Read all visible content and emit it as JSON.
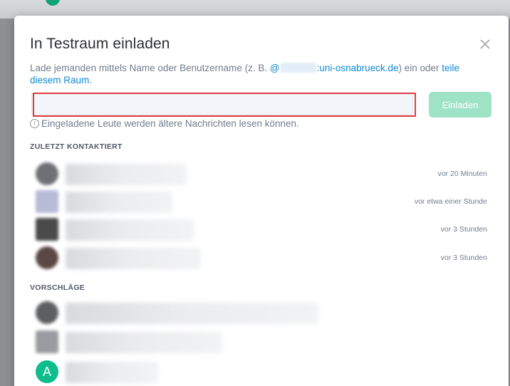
{
  "dialog": {
    "title": "In Testraum einladen",
    "description_prefix": "Lade jemanden mittels Name oder Benutzername (z. B. ",
    "mention_at": "@",
    "mention_domain": ":uni-osnabrueck.de",
    "description_middle": ") ein oder ",
    "share_link": "teile diesem Raum",
    "description_suffix": ".",
    "input": {
      "value": "",
      "placeholder": ""
    },
    "invite_button": "Einladen",
    "hint": "Eingeladene Leute werden ältere Nachrichten lesen können.",
    "close_icon": "close-icon",
    "accent_color": "#0dbd8b",
    "highlight_color": "#e03a41"
  },
  "recent": {
    "heading": "ZULETZT KONTAKTIERT",
    "items": [
      {
        "time": "vor 20 Minuten"
      },
      {
        "time": "vor etwa einer Stunde"
      },
      {
        "time": "vor 3 Stunden"
      },
      {
        "time": "vor 3 Stunden"
      }
    ]
  },
  "suggestions": {
    "heading": "VORSCHLÄGE",
    "items": [
      {
        "avatar_letter": ""
      },
      {
        "avatar_letter": ""
      },
      {
        "avatar_letter": "A"
      }
    ]
  }
}
